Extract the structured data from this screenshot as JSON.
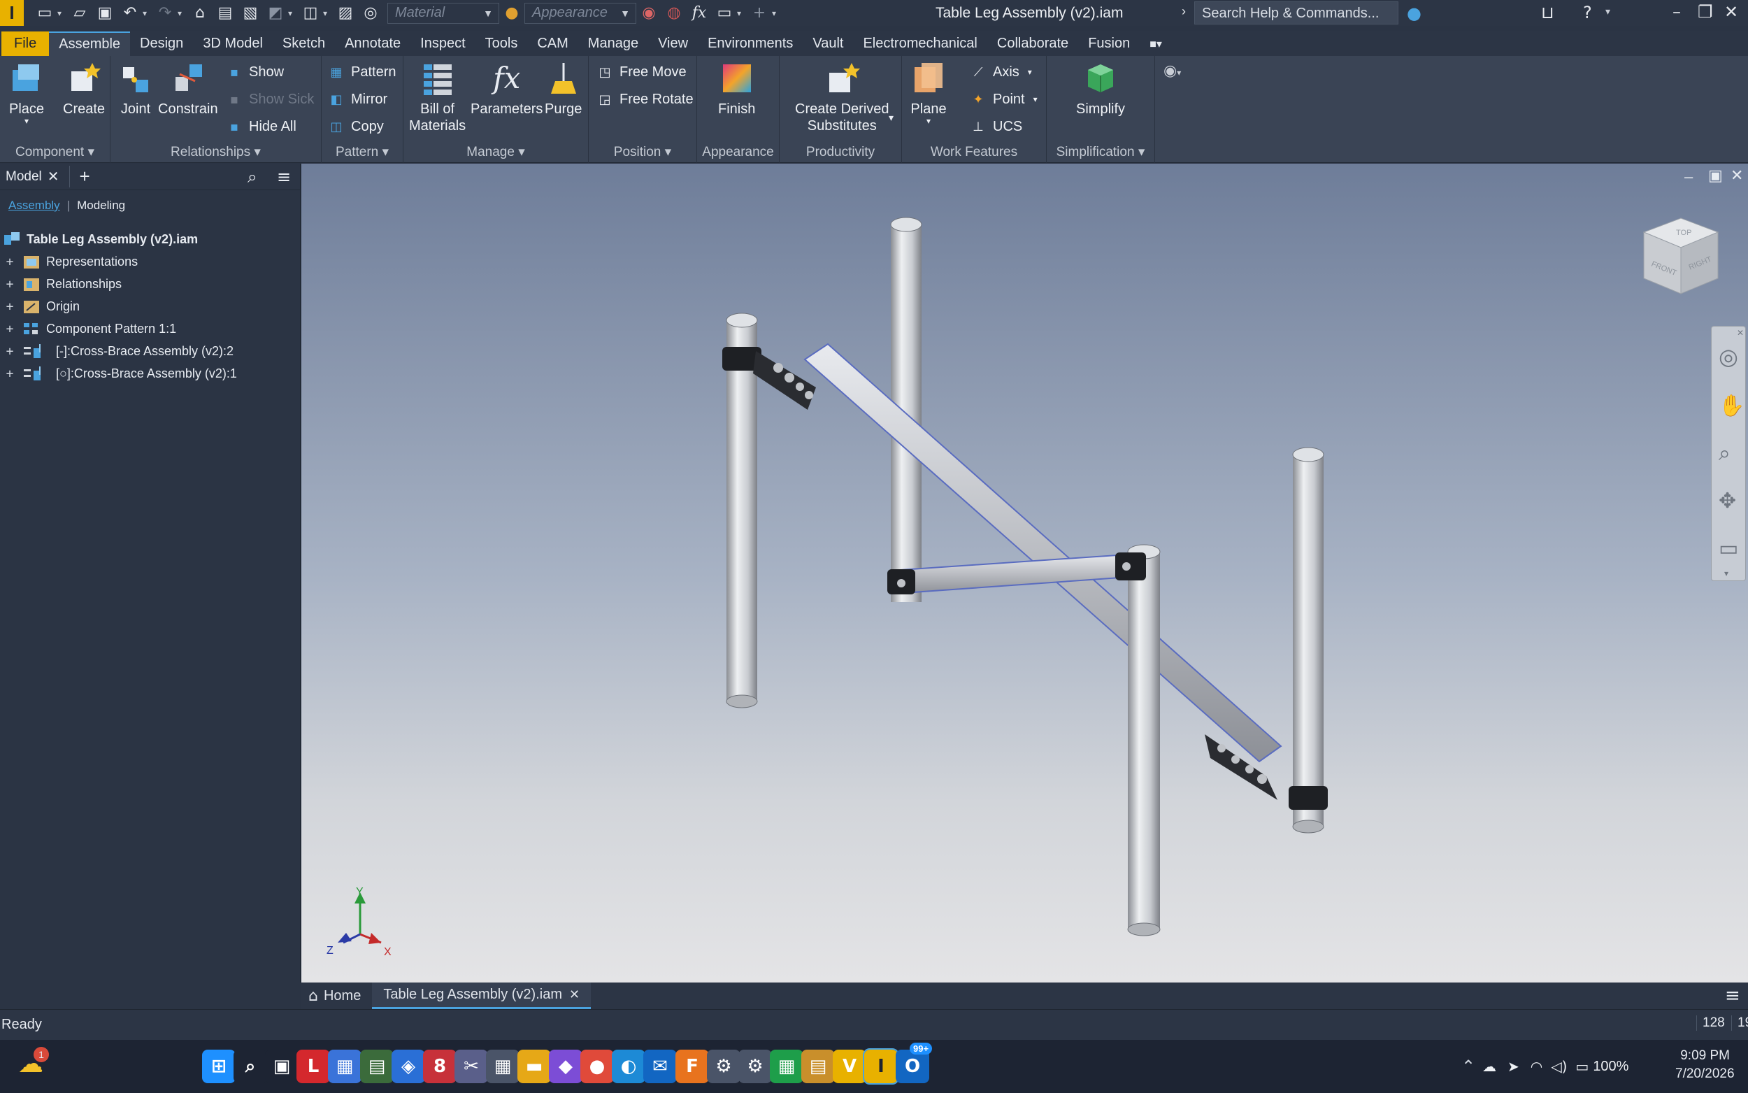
{
  "app": {
    "logo_letter": "I",
    "document_title": "Table Leg Assembly (v2).iam",
    "material_placeholder": "Material",
    "appearance_placeholder": "Appearance",
    "search_placeholder": "Search Help & Commands...",
    "fx_symbol": "fx"
  },
  "menu_tabs": [
    "File",
    "Assemble",
    "Design",
    "3D Model",
    "Sketch",
    "Annotate",
    "Inspect",
    "Tools",
    "CAM",
    "Manage",
    "View",
    "Environments",
    "Vault",
    "Electromechanical",
    "Collaborate",
    "Fusion"
  ],
  "ribbon": {
    "component": {
      "label": "Component",
      "place": "Place",
      "create": "Create"
    },
    "relationships": {
      "label": "Relationships",
      "joint": "Joint",
      "constrain": "Constrain",
      "show": "Show",
      "show_sick": "Show Sick",
      "hide_all": "Hide All"
    },
    "pattern": {
      "label": "Pattern",
      "pattern": "Pattern",
      "mirror": "Mirror",
      "copy": "Copy"
    },
    "manage": {
      "label": "Manage",
      "bom_line1": "Bill of",
      "bom_line2": "Materials",
      "parameters": "Parameters",
      "purge": "Purge"
    },
    "position": {
      "label": "Position",
      "free_move": "Free Move",
      "free_rotate": "Free Rotate"
    },
    "appearance": {
      "label": "Appearance",
      "finish": "Finish"
    },
    "productivity": {
      "label": "Productivity",
      "cds_line1": "Create Derived",
      "cds_line2": "Substitutes"
    },
    "work_features": {
      "label": "Work Features",
      "plane": "Plane",
      "axis": "Axis",
      "point": "Point",
      "ucs": "UCS"
    },
    "simplification": {
      "label": "Simplification",
      "simplify": "Simplify"
    }
  },
  "browser": {
    "tab_label": "Model",
    "subtab_assembly": "Assembly",
    "subtab_modeling": "Modeling",
    "root": "Table Leg Assembly (v2).iam",
    "items": [
      {
        "label": "Representations"
      },
      {
        "label": "Relationships"
      },
      {
        "label": "Origin"
      },
      {
        "label": "Component Pattern 1:1"
      },
      {
        "label": "[-]:Cross-Brace Assembly (v2):2"
      },
      {
        "label": "[○]:Cross-Brace Assembly (v2):1"
      }
    ]
  },
  "viewcube": {
    "top": "TOP",
    "front": "FRONT",
    "right": "RIGHT"
  },
  "triad": {
    "y": "Y",
    "z": "Z",
    "x": "X"
  },
  "doc_tabs": {
    "home": "Home",
    "active": "Table Leg Assembly (v2).iam"
  },
  "status": {
    "text": "Ready",
    "count1": "128",
    "count2": "19"
  },
  "taskbar": {
    "weather_badge": "1",
    "outlook_badge": "99+",
    "battery": "100%",
    "time": "9:09 PM",
    "date": "7/20/2026",
    "icons": [
      {
        "name": "start",
        "glyph": "⊞",
        "color": "#1e90ff"
      },
      {
        "name": "search",
        "glyph": "⌕",
        "color": "#1d2433"
      },
      {
        "name": "task-view",
        "glyph": "▣",
        "color": "#1d2433"
      },
      {
        "name": "l-app",
        "glyph": "L",
        "color": "#d4282d"
      },
      {
        "name": "store",
        "glyph": "▦",
        "color": "#3a73d9"
      },
      {
        "name": "gpu",
        "glyph": "▤",
        "color": "#3b6b3b"
      },
      {
        "name": "defender",
        "glyph": "◈",
        "color": "#2a6fd6"
      },
      {
        "name": "app-8",
        "glyph": "8",
        "color": "#c7313a"
      },
      {
        "name": "snip",
        "glyph": "✂",
        "color": "#5a5f8a"
      },
      {
        "name": "calculator",
        "glyph": "▦",
        "color": "#4a5468"
      },
      {
        "name": "explorer",
        "glyph": "▬",
        "color": "#e6a817"
      },
      {
        "name": "m365",
        "glyph": "◆",
        "color": "#7c4dd6"
      },
      {
        "name": "chrome",
        "glyph": "●",
        "color": "#e04a3a"
      },
      {
        "name": "edge",
        "glyph": "◐",
        "color": "#1d8ad6"
      },
      {
        "name": "outlook-mail",
        "glyph": "✉",
        "color": "#1266c2"
      },
      {
        "name": "fusion",
        "glyph": "F",
        "color": "#e8731e"
      },
      {
        "name": "app-16",
        "glyph": "⚙",
        "color": "#4a5468"
      },
      {
        "name": "app-17",
        "glyph": "⚙",
        "color": "#4a5468"
      },
      {
        "name": "sheets",
        "glyph": "▦",
        "color": "#1e9e4a"
      },
      {
        "name": "app-19",
        "glyph": "▤",
        "color": "#c98f2b"
      },
      {
        "name": "vault",
        "glyph": "V",
        "color": "#e8b100"
      },
      {
        "name": "inventor",
        "glyph": "I",
        "color": "#e8b100"
      },
      {
        "name": "outlook",
        "glyph": "O",
        "color": "#1266c2"
      }
    ]
  }
}
